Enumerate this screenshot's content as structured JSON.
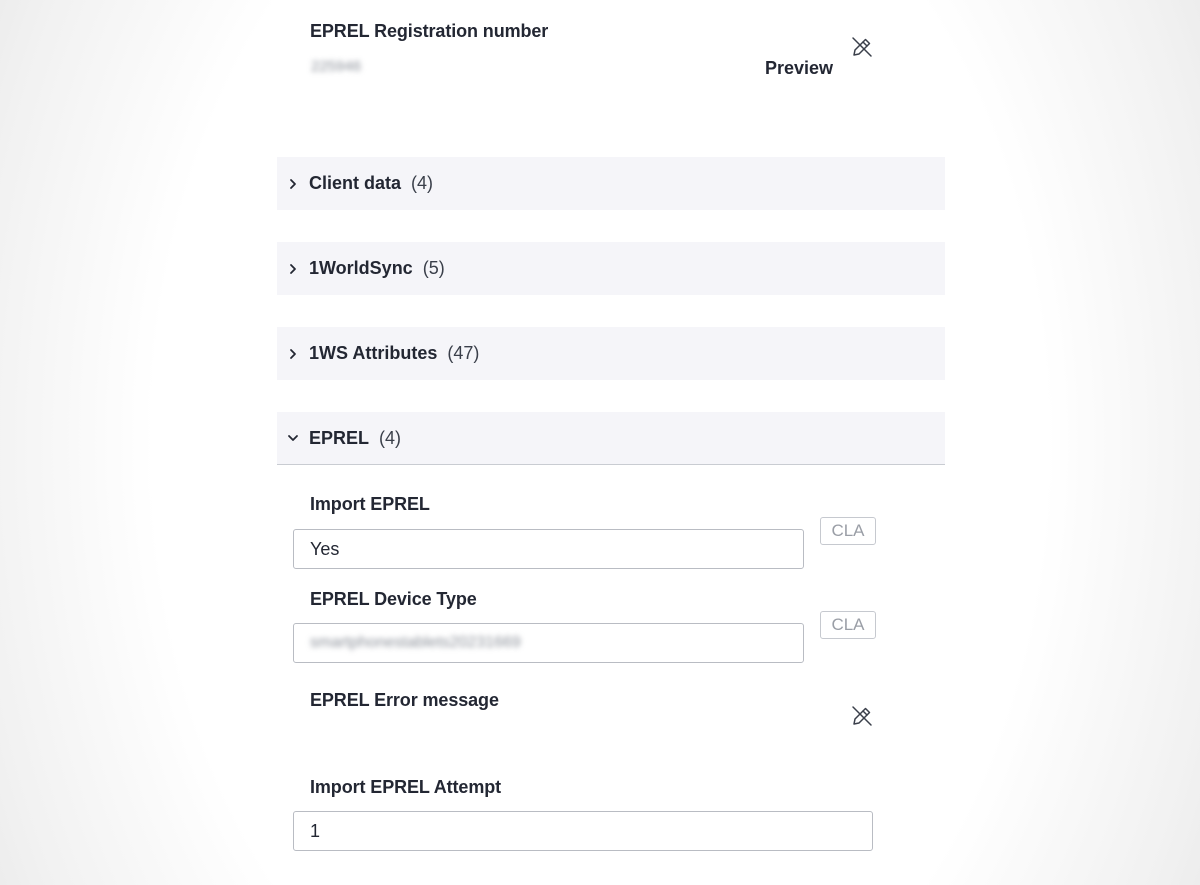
{
  "top_field": {
    "label": "EPREL Registration number",
    "value": "225946",
    "preview_label": "Preview",
    "edit_icon": "pencil-slash-icon"
  },
  "sections": [
    {
      "title": "Client data",
      "count": "(4)",
      "expanded": false
    },
    {
      "title": "1WorldSync",
      "count": "(5)",
      "expanded": false
    },
    {
      "title": "1WS Attributes",
      "count": "(47)",
      "expanded": false
    },
    {
      "title": "EPREL",
      "count": "(4)",
      "expanded": true
    }
  ],
  "eprel_fields": {
    "import_eprel": {
      "label": "Import EPREL",
      "value": "Yes",
      "button": "CLA"
    },
    "device_type": {
      "label": "EPREL Device Type",
      "value": "smartphonestablets20231669",
      "button": "CLA"
    },
    "error_message": {
      "label": "EPREL Error message",
      "edit_icon": "pencil-slash-icon"
    },
    "import_attempt": {
      "label": "Import EPREL Attempt",
      "value": "1"
    }
  }
}
